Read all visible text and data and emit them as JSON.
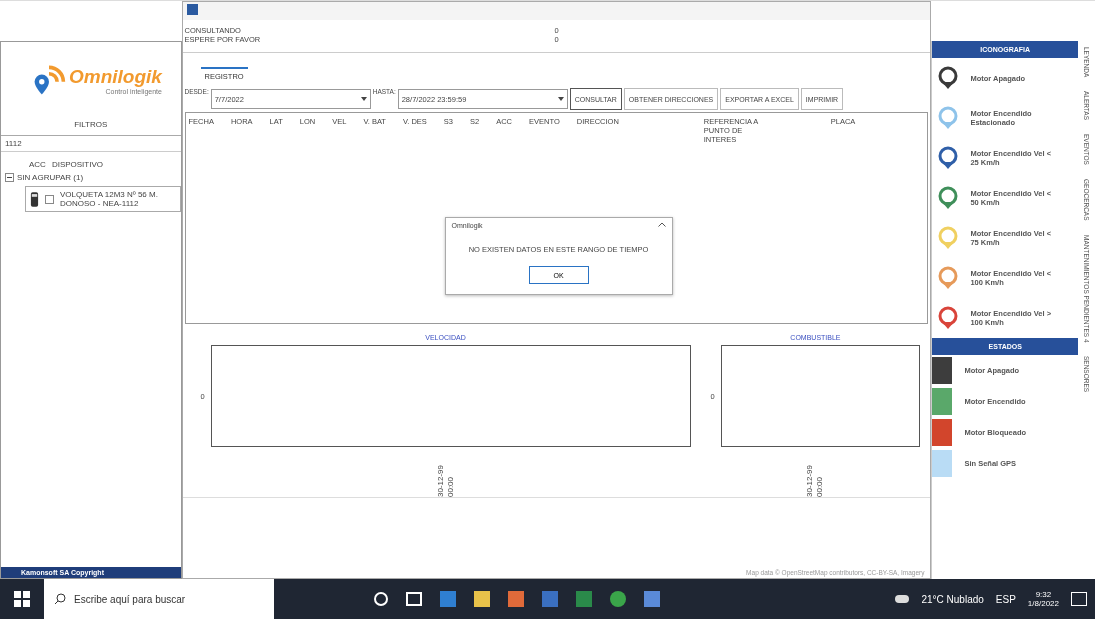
{
  "sidebar": {
    "logo": "Omnilogik",
    "tagline": "Control inteligente",
    "filters_label": "FILTROS",
    "search_value": "1112",
    "columns": [
      "ACC",
      "DISPOSITIVO"
    ],
    "group": {
      "label": "SIN AGRUPAR (1)",
      "expanded": true,
      "devices": [
        {
          "name": "VOLQUETA 12M3 Nº 56 M. DONOSO - NEA-1112",
          "checked": false
        }
      ]
    },
    "footer": "Kamonsoft SA Copyright"
  },
  "dialog": {
    "status": [
      {
        "label": "CONSULTANDO",
        "value": "0"
      },
      {
        "label": "ESPERE POR FAVOR",
        "value": "0"
      }
    ],
    "tabs": [
      {
        "label": "REGISTRO",
        "selected": true
      }
    ],
    "from_label": "DESDE:",
    "from_value": "7/7/2022",
    "to_label": "HASTA:",
    "to_value": "28/7/2022 23:59:59",
    "buttons": [
      "CONSULTAR",
      "OBTENER DIRECCIONES",
      "EXPORTAR A EXCEL",
      "IMPRIMIR"
    ],
    "columns": [
      "FECHA",
      "HORA",
      "LAT",
      "LON",
      "VEL",
      "V. BAT",
      "V. DES",
      "S3",
      "S2",
      "ACC",
      "EVENTO",
      "DIRECCION",
      "REFERENCIA A PUNTO DE INTERES",
      "PLACA"
    ],
    "charts": [
      {
        "title": "VELOCIDAD",
        "y_tick": "0",
        "x_tick": "30-12-99 00:00"
      },
      {
        "title": "COMBUSTIBLE",
        "y_tick": "0",
        "x_tick": "30-12-99 00:00"
      }
    ]
  },
  "message_box": {
    "title": "Omnilogik",
    "text": "NO EXISTEN DATOS EN ESTE RANGO DE TIEMPO",
    "button": "OK"
  },
  "map": {
    "attribution": "Map data © OpenStreetMap contributors, CC-BY-SA, Imagery"
  },
  "legend": {
    "icon_header": "ICONOGRAFIA",
    "icons": [
      {
        "label": "Motor Apagado",
        "color": "#3a3a3a"
      },
      {
        "label": "Motor Encendido Estacionado",
        "color": "#8ec3ea"
      },
      {
        "label": "Motor Encendido Vel < 25 Km/h",
        "color": "#2f5fa8"
      },
      {
        "label": "Motor Encendido Vel < 50 Km/h",
        "color": "#3f8f5a"
      },
      {
        "label": "Motor Encendido Vel < 75 Km/h",
        "color": "#f0d060"
      },
      {
        "label": "Motor Encendido Vel < 100 Km/h",
        "color": "#e69a5a"
      },
      {
        "label": "Motor Encendido Vel > 100 Km/h",
        "color": "#d9443a"
      }
    ],
    "state_header": "ESTADOS",
    "states": [
      {
        "label": "Motor Apagado",
        "color": "#3d3d3d"
      },
      {
        "label": "Motor Encendido",
        "color": "#5aa86a"
      },
      {
        "label": "Motor Bloqueado",
        "color": "#d2452c"
      },
      {
        "label": "Sin Señal GPS",
        "color": "#b9dcf5"
      }
    ]
  },
  "side_tabs": [
    "LEYENDA",
    "ALERTAS",
    "EVENTOS",
    "GEOCERCAS",
    "MANTENIMIENTOS PENDIENTES 4",
    "SENSORES"
  ],
  "taskbar": {
    "search_placeholder": "Escribe aquí para buscar",
    "weather": "21°C Nublado",
    "language": "ESP",
    "time": "9:32",
    "date": "1/8/2022"
  }
}
